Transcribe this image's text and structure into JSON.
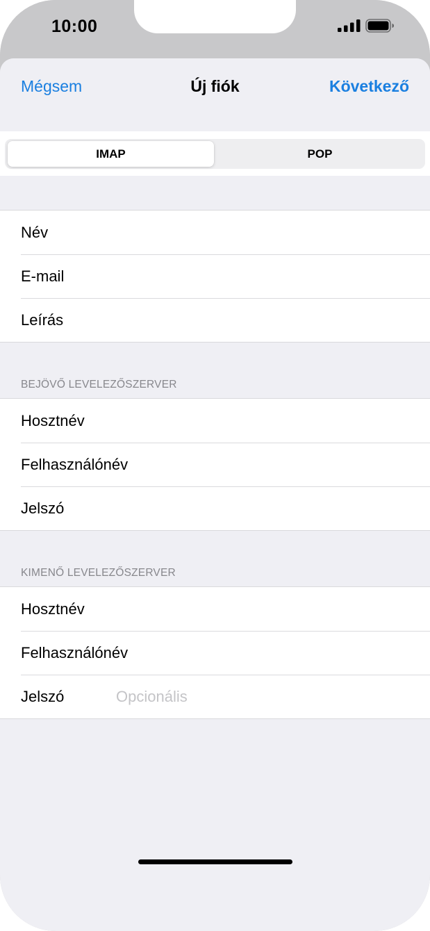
{
  "status_bar": {
    "time": "10:00"
  },
  "navbar": {
    "cancel_label": "Mégsem",
    "title": "Új fiók",
    "next_label": "Következő"
  },
  "segmented_control": {
    "options": [
      "IMAP",
      "POP"
    ],
    "selected": "IMAP"
  },
  "account_group": {
    "rows": [
      {
        "label": "Név"
      },
      {
        "label": "E-mail"
      },
      {
        "label": "Leírás"
      }
    ]
  },
  "incoming_server": {
    "header": "BEJÖVŐ LEVELEZŐSZERVER",
    "rows": [
      {
        "label": "Hosztnév"
      },
      {
        "label": "Felhasználónév"
      },
      {
        "label": "Jelszó"
      }
    ]
  },
  "outgoing_server": {
    "header": "KIMENŐ LEVELEZŐSZERVER",
    "rows": [
      {
        "label": "Hosztnév"
      },
      {
        "label": "Felhasználónév"
      },
      {
        "label": "Jelszó",
        "placeholder": "Opcionális"
      }
    ]
  },
  "colors": {
    "accent": "#1a7fe0",
    "background": "#efeff4",
    "placeholder": "#c4c4c7"
  },
  "icons": [
    "signal-icon",
    "battery-icon"
  ]
}
